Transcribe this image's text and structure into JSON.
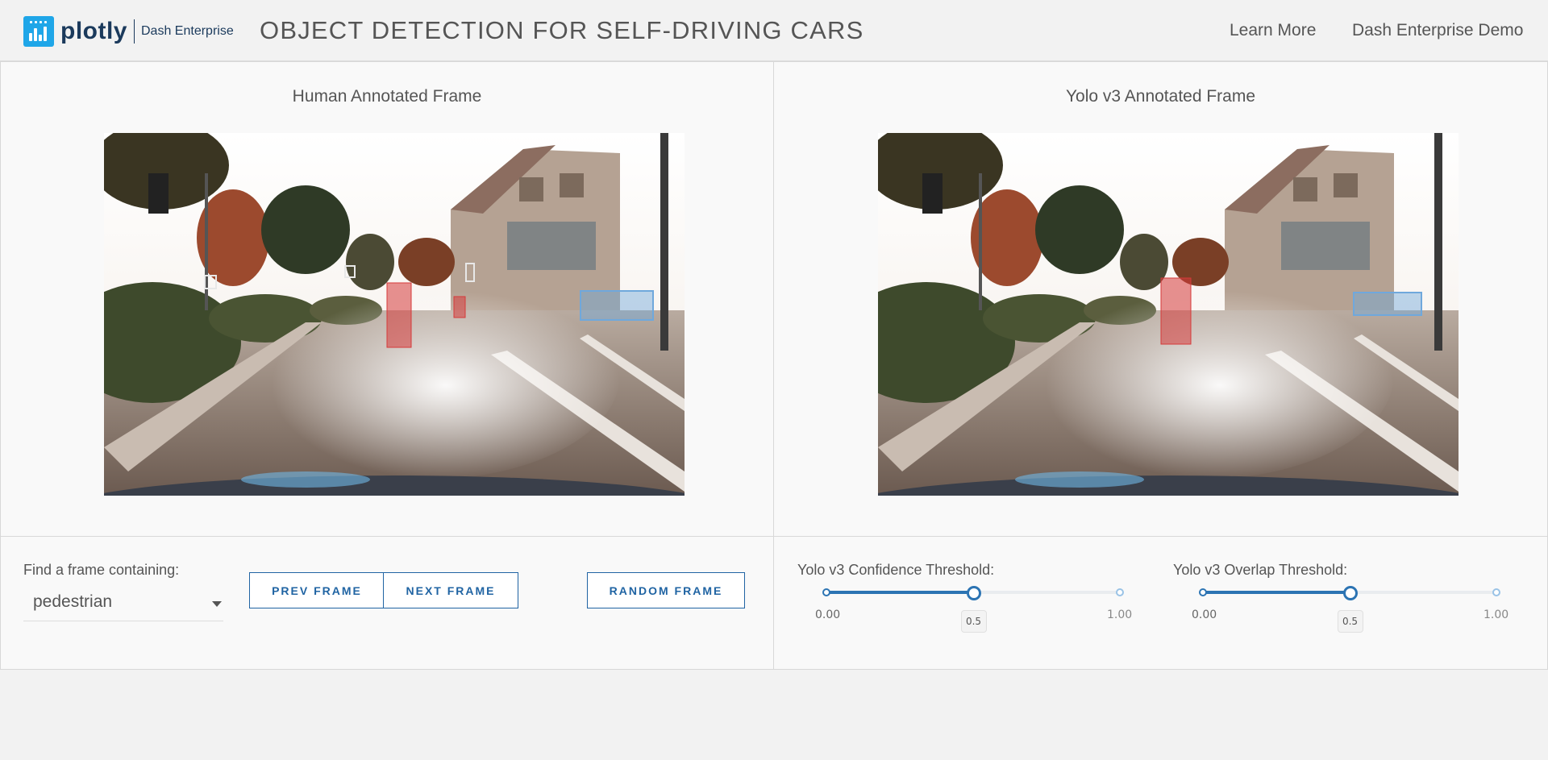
{
  "header": {
    "logo_word": "plotly",
    "logo_sub": "Dash Enterprise",
    "title": "OBJECT DETECTION FOR SELF-DRIVING CARS",
    "nav": [
      "Learn More",
      "Dash Enterprise Demo"
    ]
  },
  "left_panel": {
    "title": "Human Annotated Frame"
  },
  "right_panel": {
    "title": "Yolo v3 Annotated Frame"
  },
  "controls": {
    "find_label": "Find a frame containing:",
    "dropdown_value": "pedestrian",
    "prev_button": "PREV FRAME",
    "next_button": "NEXT FRAME",
    "random_button": "RANDOM FRAME"
  },
  "sliders": {
    "confidence": {
      "label": "Yolo v3 Confidence Threshold:",
      "min_label": "0.00",
      "max_label": "1.00",
      "value_label": "0.5",
      "value": 0.5
    },
    "overlap": {
      "label": "Yolo v3 Overlap Threshold:",
      "min_label": "0.00",
      "max_label": "1.00",
      "value_label": "0.5",
      "value": 0.5
    }
  },
  "colors": {
    "accent": "#2c74b3",
    "button_text": "#2064a3",
    "pedestrian_box": "#d63a3a",
    "car_box": "#6fa8dc",
    "traffic_light_box": "#e8e8e8",
    "logo_blue": "#1fa6e8"
  }
}
